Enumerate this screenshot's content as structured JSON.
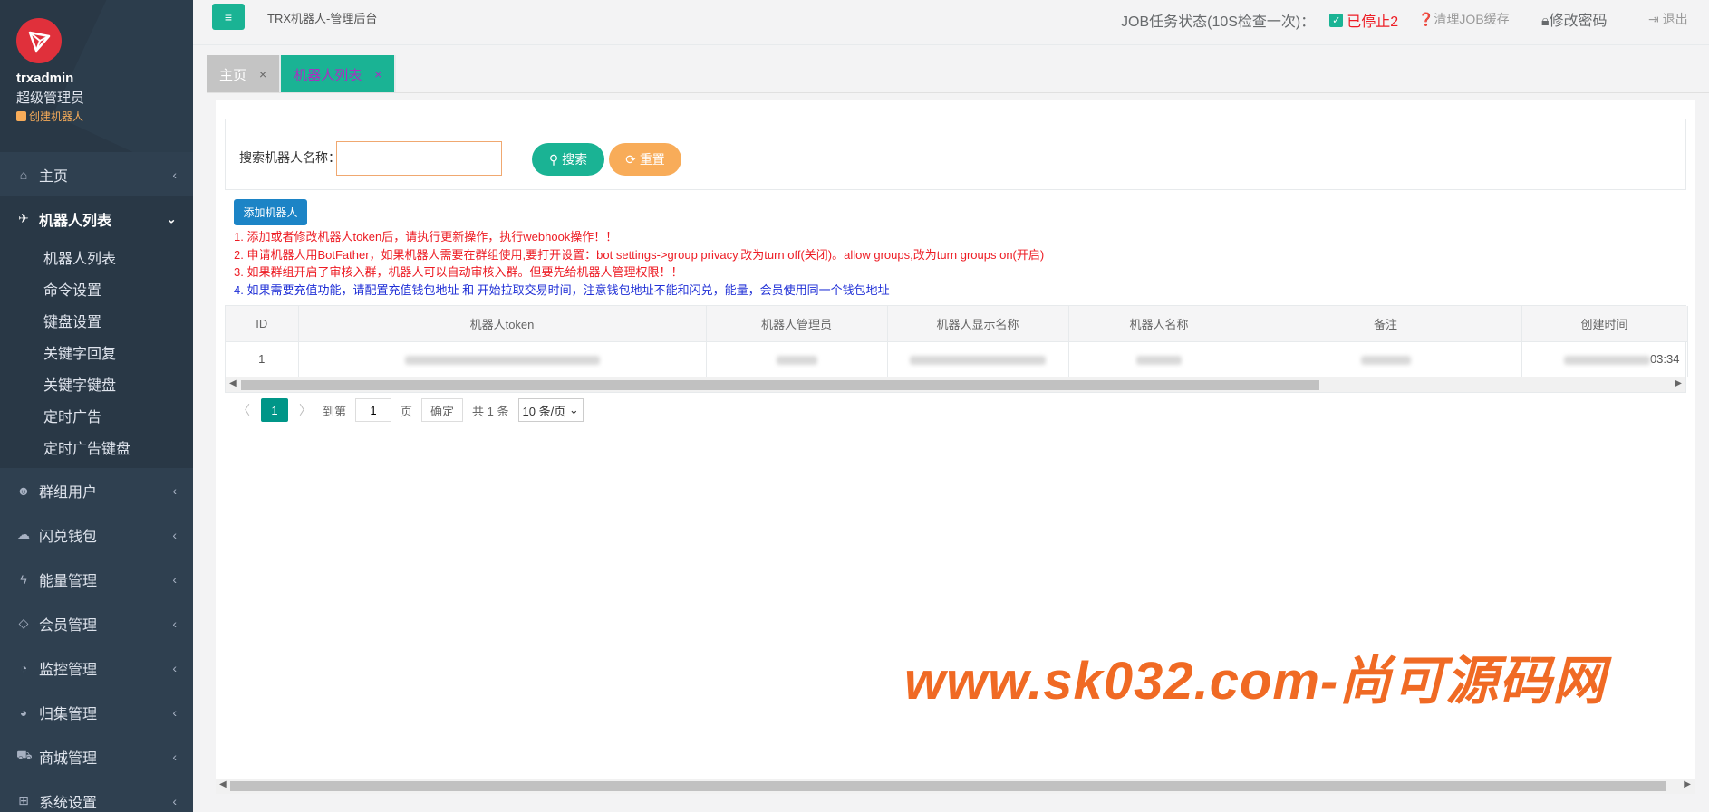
{
  "sidebar": {
    "user": {
      "name": "trxadmin",
      "role": "超级管理员",
      "link": "创建机器人"
    },
    "menu_top": [
      {
        "label": "主页",
        "icon": "home-icon",
        "glyph": "⌂",
        "has_arrow": true
      }
    ],
    "active_menu": {
      "label": "机器人列表",
      "icon": "plane-icon",
      "glyph": "✈"
    },
    "submenu": [
      "机器人列表",
      "命令设置",
      "键盘设置",
      "关键字回复",
      "关键字键盘",
      "定时广告",
      "定时广告键盘"
    ],
    "menu_bottom": [
      {
        "label": "群组用户",
        "icon": "users-icon",
        "glyph": "☻"
      },
      {
        "label": "闪兑钱包",
        "icon": "cloud-icon",
        "glyph": "☁"
      },
      {
        "label": "能量管理",
        "icon": "bolt-icon",
        "glyph": "ϟ"
      },
      {
        "label": "会员管理",
        "icon": "diamond-icon",
        "glyph": "◇"
      },
      {
        "label": "监控管理",
        "icon": "pie-chart-icon",
        "glyph": "◔"
      },
      {
        "label": "归集管理",
        "icon": "dashboard-icon",
        "glyph": "◕"
      },
      {
        "label": "商城管理",
        "icon": "cart-icon",
        "glyph": "⛟"
      },
      {
        "label": "系统设置",
        "icon": "windows-icon",
        "glyph": "⊞"
      }
    ]
  },
  "topbar": {
    "menu_toggle_glyph": "≡",
    "title": "TRX机器人-管理后台",
    "job_status_label": "JOB任务状态(10S检查一次)：",
    "job_status_value": "已停止2",
    "clear_job": "❓清理JOB缓存",
    "change_password": "修改密码",
    "logout": "退出"
  },
  "tabs": [
    {
      "label": "主页",
      "close": "×"
    },
    {
      "label": "机器人列表",
      "close": "×"
    }
  ],
  "search": {
    "label": "搜索机器人名称：",
    "value": "",
    "placeholder": "",
    "search_button": "搜索",
    "reset_button": "重置"
  },
  "add_button": "添加机器人",
  "notes": [
    "1. 添加或者修改机器人token后，请执行更新操作，执行webhook操作！！",
    "2. 申请机器人用BotFather，如果机器人需要在群组使用,要打开设置：bot settings->group privacy,改为turn off(关闭)。allow groups,改为turn groups on(开启)",
    "3. 如果群组开启了审核入群，机器人可以自动审核入群。但要先给机器人管理权限！！",
    "4. 如果需要充值功能，请配置充值钱包地址 和 开始拉取交易时间，注意钱包地址不能和闪兑，能量，会员使用同一个钱包地址"
  ],
  "table": {
    "columns": [
      "ID",
      "机器人token",
      "机器人管理员",
      "机器人显示名称",
      "机器人名称",
      "备注",
      "创建时间"
    ],
    "rows": [
      {
        "id": "1",
        "created_suffix": "03:34"
      }
    ]
  },
  "pager": {
    "current_page": "1",
    "goto_label": "到第",
    "goto_value": "1",
    "page_unit": "页",
    "confirm": "确定",
    "total": "共 1 条",
    "page_size": "10 条/页"
  },
  "watermark": "www.sk032.com-尚可源码网",
  "colors": {
    "accent": "#1ab394",
    "warning": "#f8ac59",
    "primary": "#1c84c6",
    "sidebar": "#2f4050",
    "danger": "#ed1c24"
  }
}
